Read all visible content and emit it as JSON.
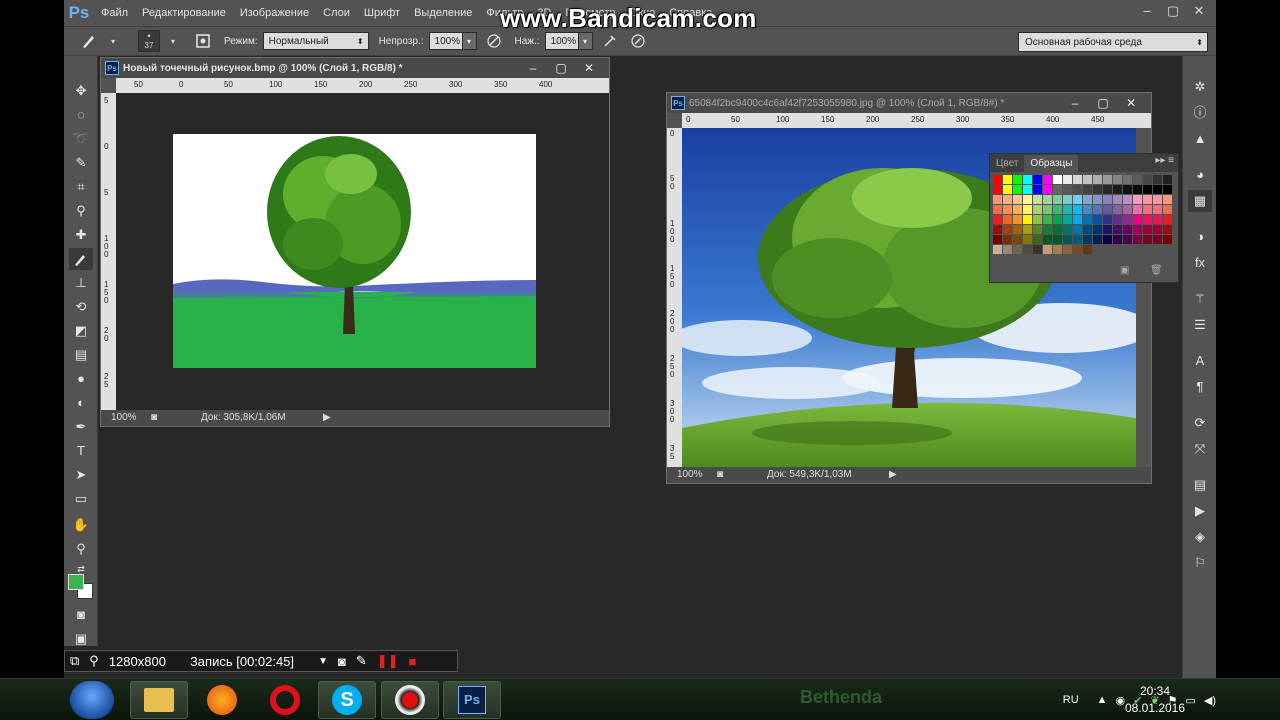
{
  "app": {
    "logo": "Ps",
    "menu": [
      "Файл",
      "Редактирование",
      "Изображение",
      "Слои",
      "Шрифт",
      "Выделение",
      "Фильтр",
      "3D",
      "Просмотр",
      "Окно",
      "Справка"
    ],
    "window_controls": [
      "–",
      "▢",
      "✕"
    ]
  },
  "watermark": "www.Bandicam.com",
  "options_bar": {
    "brush_size": "37",
    "mode_label": "Режим:",
    "mode_value": "Нормальный",
    "opacity_label": "Непрозр.:",
    "opacity_value": "100%",
    "pressure_label": "Наж.:",
    "pressure_value": "100%",
    "workspace": "Основная рабочая среда"
  },
  "doc1": {
    "title": "Новый точечный рисунок.bmp @ 100% (Слой 1, RGB/8) *",
    "zoom": "100%",
    "doc_info": "Док: 305,8K/1,06M",
    "ruler_h": [
      "50",
      "0",
      "50",
      "100",
      "150",
      "200",
      "250",
      "300",
      "350",
      "400"
    ],
    "ruler_v": [
      "5",
      "0",
      "5",
      "1 0 0",
      "1 5 0",
      "2 0",
      "2 5"
    ]
  },
  "doc2": {
    "title": "65084f2bc9400c4c6af42f7253055980.jpg @ 100% (Слой 1, RGB/8#) *",
    "zoom": "100%",
    "doc_info": "Док: 549,3K/1,03M",
    "ruler_h": [
      "0",
      "50",
      "100",
      "150",
      "200",
      "250",
      "300",
      "350",
      "400",
      "450"
    ],
    "ruler_v": [
      "0",
      "5 0",
      "1 0 0",
      "1 5 0",
      "2 0 0",
      "2 5 0",
      "3 0 0",
      "3 5"
    ]
  },
  "swatches": {
    "tabs": [
      "Цвет",
      "Образцы"
    ],
    "colors_row1": [
      "#ff0000",
      "#ffff00",
      "#00ff00",
      "#00ffff",
      "#0000ff",
      "#ff00ff",
      "#ffffff",
      "#ebebeb",
      "#d6d6d6",
      "#c2c2c2",
      "#adadad",
      "#999999",
      "#858585",
      "#707070",
      "#5c5c5c",
      "#474747",
      "#333333",
      "#1f1f1f"
    ],
    "colors_row2": [
      "#ff0000",
      "#ffff00",
      "#00ff00",
      "#00ffff",
      "#0000ff",
      "#ff00ff",
      "#666666",
      "#5a5a5a",
      "#4e4e4e",
      "#424242",
      "#363636",
      "#2a2a2a",
      "#1e1e1e",
      "#121212",
      "#0a0a0a",
      "#050505",
      "#000000",
      "#000000"
    ],
    "palette_rows": [
      [
        "#f7977a",
        "#f9ad81",
        "#fdc68a",
        "#fff79a",
        "#c4df9b",
        "#a2d39c",
        "#82ca9d",
        "#7bcdc8",
        "#6ecff6",
        "#7ea7d8",
        "#8493ca",
        "#8882be",
        "#a187be",
        "#bc8dbf",
        "#f49ac2",
        "#f6989d",
        "#f6989d",
        "#f7977a"
      ],
      [
        "#f26c4f",
        "#f68e55",
        "#fbaf5c",
        "#fff467",
        "#acd372",
        "#7cc576",
        "#3bb878",
        "#1abbb4",
        "#00bff3",
        "#438ccb",
        "#5574b9",
        "#605ca8",
        "#855fa8",
        "#a763a8",
        "#f06ea9",
        "#f26d7d",
        "#f26d7d",
        "#f26c4f"
      ],
      [
        "#ed1c24",
        "#f26522",
        "#f7941d",
        "#fff200",
        "#8dc63f",
        "#39b54a",
        "#00a651",
        "#00a99d",
        "#00aeef",
        "#0072bc",
        "#0054a6",
        "#2e3192",
        "#662d91",
        "#92278f",
        "#ec008c",
        "#ed145b",
        "#ed145b",
        "#ed1c24"
      ],
      [
        "#9e0b0f",
        "#a0410d",
        "#a36209",
        "#aba000",
        "#598527",
        "#1a7b30",
        "#007236",
        "#00746b",
        "#0076a3",
        "#004b80",
        "#003471",
        "#1b1464",
        "#440e62",
        "#630460",
        "#9e005d",
        "#9e0039",
        "#9e0039",
        "#9e0b0f"
      ],
      [
        "#790000",
        "#7b2e00",
        "#7d4900",
        "#827b00",
        "#406618",
        "#005e20",
        "#005826",
        "#005952",
        "#005b7f",
        "#003663",
        "#002157",
        "#0d004c",
        "#32004b",
        "#4b0049",
        "#7b0046",
        "#7a0026",
        "#7a0026",
        "#790000"
      ],
      [
        "#c7b299",
        "#998675",
        "#736357",
        "#534741",
        "#37302d",
        "#c69c6d",
        "#a67c52",
        "#8c6239",
        "#754c24",
        "#603913",
        "#535353",
        "#535353",
        "#535353",
        "#535353",
        "#535353",
        "#535353",
        "#535353",
        "#535353"
      ]
    ]
  },
  "bandicam": {
    "resolution": "1280x800",
    "record": "Запись [00:02:45]"
  },
  "taskbar": {
    "lang": "RU",
    "time": "20:34",
    "date": "08.01.2016",
    "watermark_text": "Bethenda"
  },
  "colors": {
    "foreground": "#3cb34e",
    "background": "#ffffff",
    "ps_blue": "#6db3f2"
  }
}
